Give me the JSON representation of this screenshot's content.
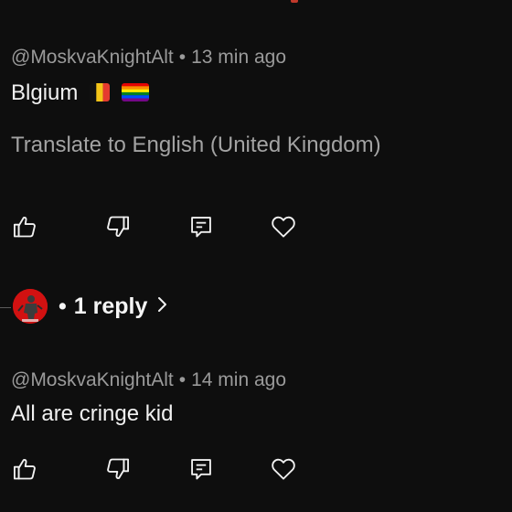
{
  "comments": [
    {
      "author": "@MoskvaKnightAlt",
      "separator": "•",
      "time": "13 min ago",
      "text": "Blgium",
      "flags": [
        "belgium-flag-emoji",
        "rainbow-flag-emoji"
      ],
      "translate_label": "Translate to English (United Kingdom)",
      "actions": [
        "like-icon",
        "dislike-icon",
        "reply-icon",
        "heart-icon"
      ]
    },
    {
      "author": "@MoskvaKnightAlt",
      "separator": "•",
      "time": "14 min ago",
      "text": "All are cringe kid",
      "actions": [
        "like-icon",
        "dislike-icon",
        "reply-icon",
        "heart-icon"
      ]
    }
  ],
  "replies": {
    "separator": "•",
    "label": "1 reply",
    "chevron_icon": "chevron-right-icon"
  },
  "colors": {
    "background": "#0e0e0e",
    "primary_text": "#f1f1f1",
    "secondary_text": "#9a9a9a",
    "avatar_red": "#d11111"
  }
}
